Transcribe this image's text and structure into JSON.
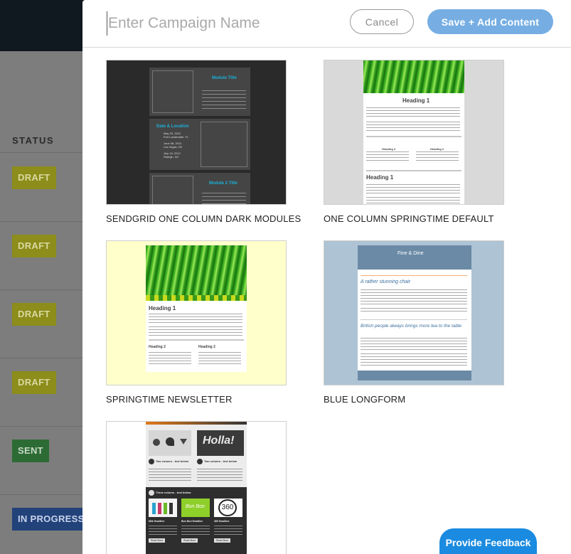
{
  "background": {
    "status_header": "STATUS",
    "badges": [
      {
        "label": "DRAFT",
        "kind": "draft"
      },
      {
        "label": "DRAFT",
        "kind": "draft"
      },
      {
        "label": "DRAFT",
        "kind": "draft"
      },
      {
        "label": "DRAFT",
        "kind": "draft"
      },
      {
        "label": "SENT",
        "kind": "sent"
      },
      {
        "label": "IN PROGRESS",
        "kind": "progress"
      }
    ]
  },
  "modal": {
    "campaign_name": {
      "value": "",
      "placeholder": "Enter Campaign Name"
    },
    "cancel_label": "Cancel",
    "save_label": "Save + Add Content",
    "templates": [
      {
        "name": "SENDGRID ONE COLUMN DARK MODULES",
        "thumb": {
          "module1_title": "Module Title",
          "date_title": "Date & Location",
          "dates": [
            "May 20, 2012",
            "Fort Lauderdale, FL",
            "June 08, 2012",
            "Las Vegas, NV",
            "July 15, 2012",
            "Raleigh, NC"
          ],
          "module2_title": "Module 2 Title"
        }
      },
      {
        "name": "ONE COLUMN SPRINGTIME DEFAULT",
        "thumb": {
          "heading": "Heading 1",
          "heading2": "Heading 2"
        }
      },
      {
        "name": "SPRINGTIME NEWSLETTER",
        "thumb": {
          "heading": "Heading 1",
          "heading2": "Heading 2"
        }
      },
      {
        "name": "BLUE LONGFORM",
        "thumb": {
          "brand": "Fine & Dine",
          "article1": "A rather stunning chair",
          "article2": "British people always brings more tea to the table"
        }
      },
      {
        "name": "",
        "thumb": {
          "holla": "Holla!",
          "two_col_a": "Two column - text below",
          "two_col_b": "Two column - text below",
          "three_col": "Three column - text below",
          "bonbon": "Bon Bon",
          "badge360": "360",
          "headlines": [
            "Milk Headline",
            "Bon Bon Headline",
            "360 Headline"
          ],
          "button_label": "Read More"
        }
      }
    ]
  },
  "feedback_label": "Provide Feedback",
  "colors": {
    "save_button": "#76aee3",
    "feedback_button": "#1a8be0",
    "draft_badge": "#8c8d1a",
    "sent_badge": "#2d6b34",
    "progress_badge": "#22427a",
    "accent_cyan": "#1ab0d6"
  }
}
